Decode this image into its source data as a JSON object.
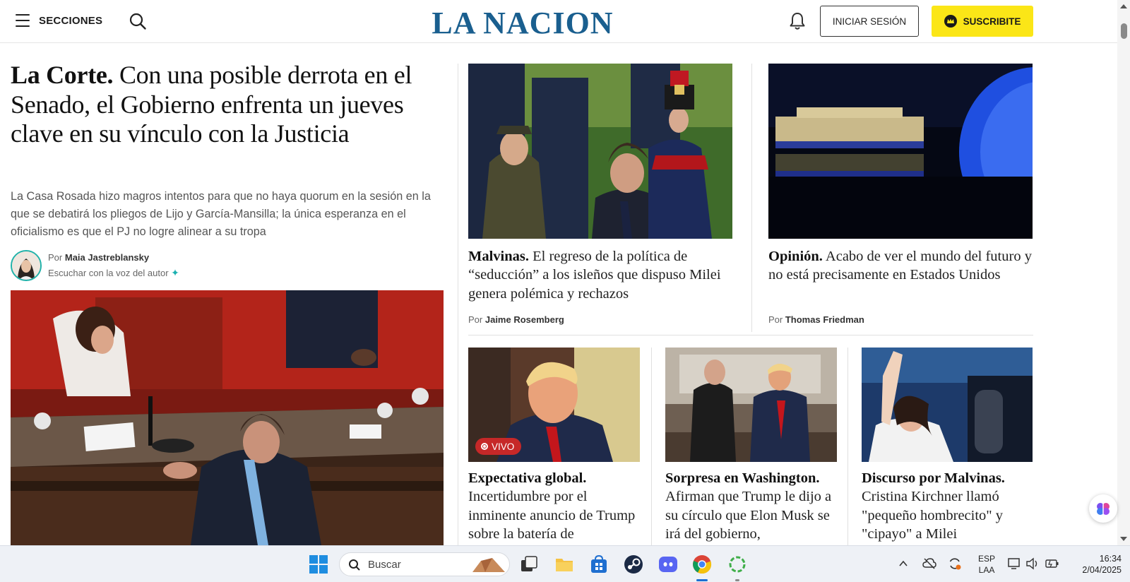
{
  "header": {
    "menu_label": "SECCIONES",
    "logo": "LA NACION",
    "login_label": "INICIAR SESIÓN",
    "subscribe_label": "SUSCRIBITE"
  },
  "lead": {
    "kicker": "La Corte.",
    "title": "Con una posible derrota en el Senado, el Gobierno enfrenta un jueves clave en su vínculo con la Justicia",
    "summary": "La Casa Rosada hizo magros intentos para que no haya quorum en la sesión en la que se debatirá los pliegos de Lijo y García-Mansilla; la única esperanza en el oficialismo es que el PJ no logre alinear a su tropa",
    "by_prefix": "Por",
    "author": "Maia Jastreblansky",
    "listen_label": "Escuchar con la voz del autor"
  },
  "cards_top": [
    {
      "kicker": "Malvinas.",
      "title": "El regreso de la política de “seducción” a los isleños que dispuso Milei genera polémica y rechazos",
      "by_prefix": "Por",
      "author": "Jaime Rosemberg"
    },
    {
      "kicker": "Opinión.",
      "title": "Acabo de ver el mundo del futuro y no está precisamente en Estados Unidos",
      "by_prefix": "Por",
      "author": "Thomas Friedman"
    }
  ],
  "cards_bottom": [
    {
      "kicker": "Expectativa global.",
      "title": "Incertidumbre por el inminente anuncio de Trump sobre la batería de",
      "badge": "VIVO"
    },
    {
      "kicker": "Sorpresa en Washington.",
      "title": "Afirman que Trump le dijo a su círculo que Elon Musk se irá del gobierno,"
    },
    {
      "kicker": "Discurso por Malvinas.",
      "title": "Cristina Kirchner llamó \"pequeño hombrecito\" y \"cipayo\" a Milei"
    }
  ],
  "taskbar": {
    "search_placeholder": "Buscar",
    "lang_line1": "ESP",
    "lang_line2": "LAA",
    "time": "16:34",
    "date": "2/04/2025"
  },
  "colors": {
    "brand": "#1a5f8f",
    "subscribe": "#fbe617",
    "live": "#c62828",
    "accent_teal": "#20b2aa"
  }
}
